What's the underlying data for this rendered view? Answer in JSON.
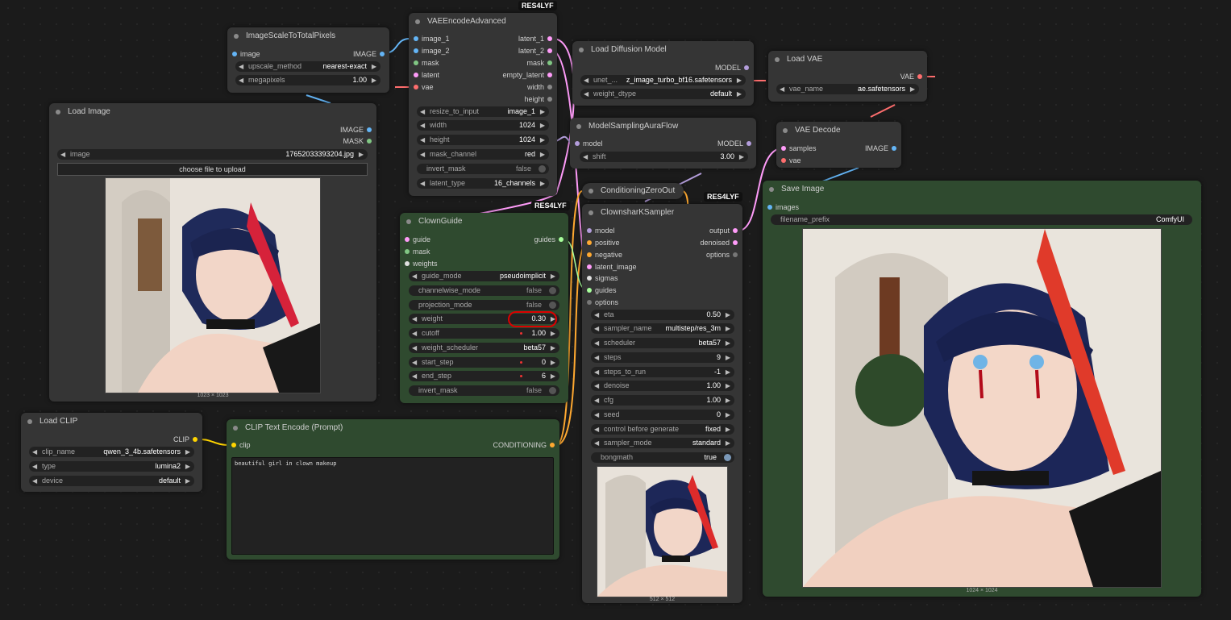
{
  "badges": {
    "vae_encode": "RES4LYF",
    "clown_guide": "RES4LYF",
    "sampler": "RES4LYF"
  },
  "image_scale": {
    "title": "ImageScaleToTotalPixels",
    "in_image": "image",
    "out_image": "IMAGE",
    "upscale_method_label": "upscale_method",
    "upscale_method_value": "nearest-exact",
    "megapixels_label": "megapixels",
    "megapixels_value": "1.00"
  },
  "load_image": {
    "title": "Load Image",
    "out_image": "IMAGE",
    "out_mask": "MASK",
    "image_label": "image",
    "image_value": "17652033393204.jpg",
    "upload_button": "choose file to upload",
    "dims": "1023 × 1023"
  },
  "vae_encode": {
    "title": "VAEEncodeAdvanced",
    "inputs": [
      "image_1",
      "image_2",
      "mask",
      "latent",
      "vae"
    ],
    "outputs": [
      "latent_1",
      "latent_2",
      "mask",
      "empty_latent",
      "width",
      "height"
    ],
    "widgets": [
      {
        "label": "resize_to_input",
        "value": "image_1"
      },
      {
        "label": "width",
        "value": "1024"
      },
      {
        "label": "height",
        "value": "1024"
      },
      {
        "label": "mask_channel",
        "value": "red"
      },
      {
        "label": "invert_mask",
        "value": "false"
      },
      {
        "label": "latent_type",
        "value": "16_channels"
      }
    ]
  },
  "load_diffusion": {
    "title": "Load Diffusion Model",
    "out_model": "MODEL",
    "unet_label": "unet_...",
    "unet_value": "z_image_turbo_bf16.safetensors",
    "dtype_label": "weight_dtype",
    "dtype_value": "default"
  },
  "load_vae": {
    "title": "Load VAE",
    "out_vae": "VAE",
    "vae_label": "vae_name",
    "vae_value": "ae.safetensors"
  },
  "model_sampling": {
    "title": "ModelSamplingAuraFlow",
    "in_model": "model",
    "out_model": "MODEL",
    "shift_label": "shift",
    "shift_value": "3.00"
  },
  "vae_decode": {
    "title": "VAE Decode",
    "in_samples": "samples",
    "in_vae": "vae",
    "out_image": "IMAGE"
  },
  "cond_zero": {
    "title": "ConditioningZeroOut"
  },
  "save_image": {
    "title": "Save Image",
    "in_images": "images",
    "prefix_label": "filename_prefix",
    "prefix_value": "ComfyUI",
    "dims": "1024 × 1024"
  },
  "clown_guide": {
    "title": "ClownGuide",
    "inputs": [
      "guide",
      "mask",
      "weights"
    ],
    "out_guides": "guides",
    "widgets": [
      {
        "label": "guide_mode",
        "value": "pseudoimplicit"
      },
      {
        "label": "channelwise_mode",
        "value": "false"
      },
      {
        "label": "projection_mode",
        "value": "false"
      },
      {
        "label": "weight",
        "value": "0.30"
      },
      {
        "label": "cutoff",
        "value": "1.00"
      },
      {
        "label": "weight_scheduler",
        "value": "beta57"
      },
      {
        "label": "start_step",
        "value": "0"
      },
      {
        "label": "end_step",
        "value": "6"
      },
      {
        "label": "invert_mask",
        "value": "false"
      }
    ]
  },
  "sampler": {
    "title": "ClownsharKSampler",
    "inputs": [
      "model",
      "positive",
      "negative",
      "latent_image",
      "sigmas",
      "guides",
      "options"
    ],
    "outputs": [
      "output",
      "denoised",
      "options"
    ],
    "widgets": [
      {
        "label": "eta",
        "value": "0.50"
      },
      {
        "label": "sampler_name",
        "value": "multistep/res_3m"
      },
      {
        "label": "scheduler",
        "value": "beta57"
      },
      {
        "label": "steps",
        "value": "9"
      },
      {
        "label": "steps_to_run",
        "value": "-1"
      },
      {
        "label": "denoise",
        "value": "1.00"
      },
      {
        "label": "cfg",
        "value": "1.00"
      },
      {
        "label": "seed",
        "value": "0"
      },
      {
        "label": "control before generate",
        "value": "fixed"
      },
      {
        "label": "sampler_mode",
        "value": "standard"
      },
      {
        "label": "bongmath",
        "value": "true"
      }
    ],
    "dims": "512 × 512"
  },
  "load_clip": {
    "title": "Load CLIP",
    "out_clip": "CLIP",
    "widgets": [
      {
        "label": "clip_name",
        "value": "qwen_3_4b.safetensors"
      },
      {
        "label": "type",
        "value": "lumina2"
      },
      {
        "label": "device",
        "value": "default"
      }
    ]
  },
  "clip_text": {
    "title": "CLIP Text Encode (Prompt)",
    "in_clip": "clip",
    "out_cond": "CONDITIONING",
    "prompt": "beautiful girl in clown makeup"
  },
  "colors": {
    "node_bg": "#353535",
    "green_node_bg": "#2f4a2f",
    "canvas_bg": "#1b1b1b",
    "image_port": "#64b5f6",
    "latent_port": "#ff9cf9",
    "vae_port": "#ff6e6e",
    "model_port": "#b39ddb",
    "clip_port": "#ffd500",
    "cond_port": "#ffa931",
    "mask_port": "#81c784",
    "guides_port": "#a8ff9c",
    "highlight_circle": "#dd0000"
  }
}
